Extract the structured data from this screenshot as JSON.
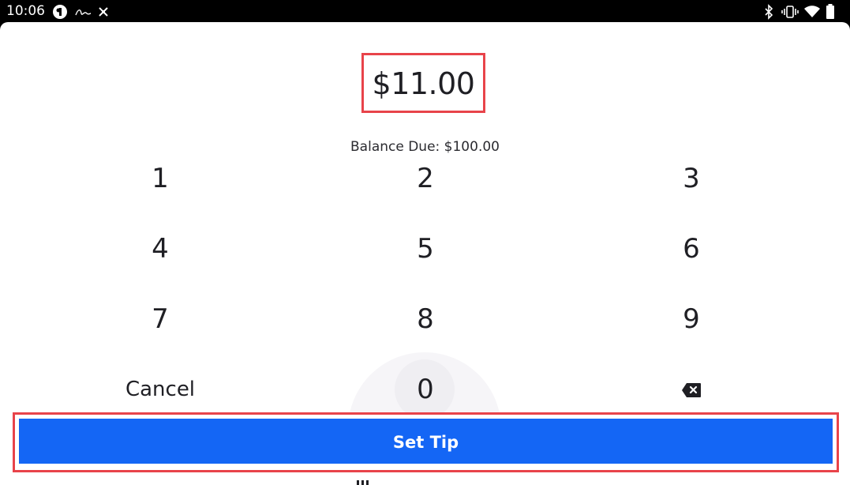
{
  "status_bar": {
    "time": "10:06",
    "left_icons": [
      "circle-app-icon",
      "handwriting-app-icon",
      "fan-app-icon"
    ],
    "right_icons": [
      "bluetooth-icon",
      "vibrate-icon",
      "wifi-icon",
      "battery-icon"
    ]
  },
  "tip": {
    "amount": "$11.00",
    "balance_due": "Balance Due: $100.00"
  },
  "keypad": {
    "keys": [
      "1",
      "2",
      "3",
      "4",
      "5",
      "6",
      "7",
      "8",
      "9",
      "Cancel",
      "0",
      "backspace-icon"
    ]
  },
  "actions": {
    "set_tip_label": "Set Tip"
  },
  "colors": {
    "primary": "#1466f5",
    "highlight": "#e8434a",
    "text": "#1f1f24"
  }
}
